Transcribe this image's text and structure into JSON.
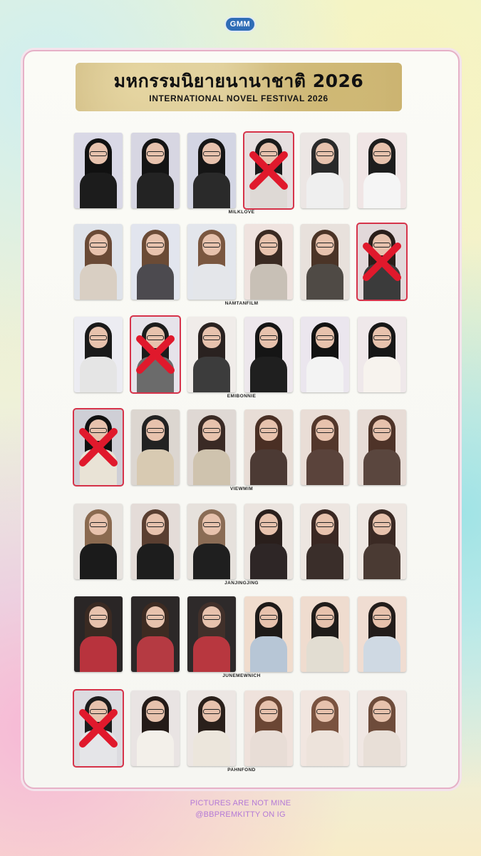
{
  "logo": {
    "text": "GMM",
    "icon": "gmm-tv-logo-icon"
  },
  "title": {
    "thai": "มหกรรมนิยายนานาชาติ 2026",
    "english": "INTERNATIONAL NOVEL FESTIVAL 2026"
  },
  "rows": [
    {
      "label": "MILKLOVE",
      "crossed": [
        4
      ],
      "cards": [
        {
          "bg": "#d9d8e6",
          "hair": "#111",
          "body": "#1c1c1c"
        },
        {
          "bg": "#d7d6e2",
          "hair": "#141414",
          "body": "#232323"
        },
        {
          "bg": "#d3d5e3",
          "hair": "#161616",
          "body": "#2a2a2a"
        },
        {
          "bg": "#e6dfe0",
          "hair": "#1a1a1a",
          "body": "#ded9d5"
        },
        {
          "bg": "#ece6e4",
          "hair": "#2a2a2a",
          "body": "#efefef"
        },
        {
          "bg": "#f0e5e5",
          "hair": "#1d1d1d",
          "body": "#f5f5f5"
        }
      ]
    },
    {
      "label": "NAMTANFILM",
      "crossed": [
        6
      ],
      "cards": [
        {
          "bg": "#dfe3ea",
          "hair": "#6a4a36",
          "body": "#d9cfc3"
        },
        {
          "bg": "#e2e5ee",
          "hair": "#6b4b36",
          "body": "#4c4a4f"
        },
        {
          "bg": "#e3e6ec",
          "hair": "#7a5740",
          "body": "#e4e6ea"
        },
        {
          "bg": "#efe3df",
          "hair": "#3a2a22",
          "body": "#c8c0b6"
        },
        {
          "bg": "#e8e1dc",
          "hair": "#4b3427",
          "body": "#4f4a45"
        },
        {
          "bg": "#e2d8da",
          "hair": "#2a1e1a",
          "body": "#3b3b3b"
        }
      ]
    },
    {
      "label": "EMIBONNIE",
      "crossed": [
        2
      ],
      "cards": [
        {
          "bg": "#ececf2",
          "hair": "#1a1a1a",
          "body": "#e5e5e5"
        },
        {
          "bg": "#e6e3ea",
          "hair": "#1c1c1c",
          "body": "#6b6b6b"
        },
        {
          "bg": "#f0ece9",
          "hair": "#2a2220",
          "body": "#3c3c3c"
        },
        {
          "bg": "#ede7ec",
          "hair": "#151515",
          "body": "#1f1f1f"
        },
        {
          "bg": "#ebe6ee",
          "hair": "#121212",
          "body": "#f3f3f3"
        },
        {
          "bg": "#efe8ea",
          "hair": "#171717",
          "body": "#f7f3ee"
        }
      ]
    },
    {
      "label": "VIEWMIM",
      "crossed": [
        1
      ],
      "cards": [
        {
          "bg": "#cfcfd6",
          "hair": "#111",
          "body": "#e9e3d6"
        },
        {
          "bg": "#dcd6d0",
          "hair": "#222",
          "body": "#d8cab2"
        },
        {
          "bg": "#dfd8d4",
          "hair": "#3a2a25",
          "body": "#cfc3ae"
        },
        {
          "bg": "#e8ddd6",
          "hair": "#4a2f24",
          "body": "#4c3a34"
        },
        {
          "bg": "#e9ddd6",
          "hair": "#53372b",
          "body": "#5a433b"
        },
        {
          "bg": "#e7dcd6",
          "hair": "#4e3328",
          "body": "#5a463e"
        }
      ]
    },
    {
      "label": "JANJINGJING",
      "crossed": [],
      "cards": [
        {
          "bg": "#e7e3df",
          "hair": "#8a6a50",
          "body": "#1b1b1b"
        },
        {
          "bg": "#e4dcd8",
          "hair": "#5a3f31",
          "body": "#1d1d1d"
        },
        {
          "bg": "#e6e1dc",
          "hair": "#8a6c55",
          "body": "#1f1f1f"
        },
        {
          "bg": "#ebe4df",
          "hair": "#2a1f1c",
          "body": "#2e2626"
        },
        {
          "bg": "#ede6e1",
          "hair": "#3a2823",
          "body": "#3a2e2a"
        },
        {
          "bg": "#eee7e2",
          "hair": "#3b2a24",
          "body": "#4a3a33"
        }
      ]
    },
    {
      "label": "JUNEMEWNICH",
      "crossed": [],
      "cards": [
        {
          "bg": "#2a2626",
          "hair": "#3a2a22",
          "body": "#b8333d"
        },
        {
          "bg": "#2c2828",
          "hair": "#3d2b22",
          "body": "#b53a42"
        },
        {
          "bg": "#2e2a2a",
          "hair": "#41302a",
          "body": "#b8373f"
        },
        {
          "bg": "#f0dccd",
          "hair": "#1e1a18",
          "body": "#b7c6d6"
        },
        {
          "bg": "#efdccf",
          "hair": "#201c1a",
          "body": "#e2ddd2"
        },
        {
          "bg": "#f0ddd2",
          "hair": "#231d1b",
          "body": "#cfd9e3"
        }
      ]
    },
    {
      "label": "PAHNFOND",
      "crossed": [
        1
      ],
      "cards": [
        {
          "bg": "#dcdbe0",
          "hair": "#1c1c1c",
          "body": "#e5e5e8"
        },
        {
          "bg": "#e9e4e3",
          "hair": "#241b18",
          "body": "#f3f0ea"
        },
        {
          "bg": "#ece6e3",
          "hair": "#2a201b",
          "body": "#ece6dc"
        },
        {
          "bg": "#efe2dc",
          "hair": "#6b4634",
          "body": "#e8ddd6"
        },
        {
          "bg": "#f1e6e0",
          "hair": "#7a5340",
          "body": "#ede3db"
        },
        {
          "bg": "#f0e7e3",
          "hair": "#6e4c3b",
          "body": "#e8dfd7"
        }
      ]
    }
  ],
  "footer": {
    "line1": "PICTURES ARE NOT MINE",
    "line2": "@BBPREMKITTY ON IG"
  }
}
